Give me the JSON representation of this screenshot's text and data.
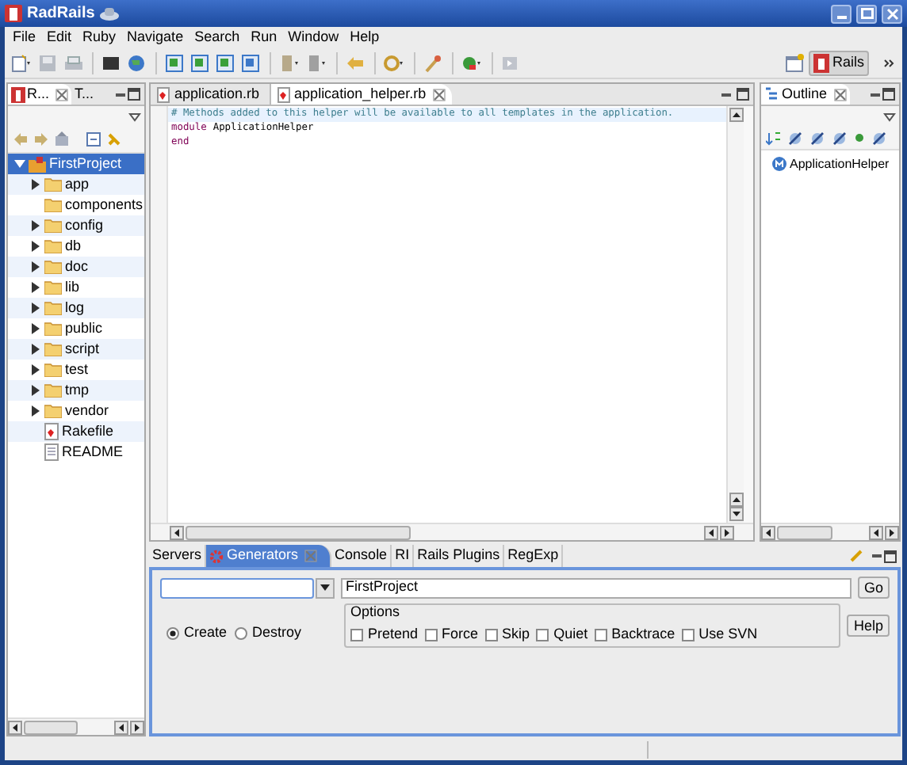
{
  "window": {
    "title": "RadRails"
  },
  "menu": [
    "File",
    "Edit",
    "Ruby",
    "Navigate",
    "Search",
    "Run",
    "Window",
    "Help"
  ],
  "toolbar": {
    "perspective": {
      "label": "Rails",
      "selected": true
    }
  },
  "explorer": {
    "tabs": [
      {
        "label": "R...",
        "selected": true
      },
      {
        "label": "T...",
        "selected": false
      }
    ],
    "tree": [
      {
        "label": "FirstProject",
        "kind": "project",
        "selected": true,
        "expandable": true,
        "expanded": true,
        "children": [
          {
            "label": "app",
            "kind": "folder",
            "selected": false,
            "expandable": true,
            "expanded": false
          },
          {
            "label": "components",
            "kind": "folder",
            "selected": false,
            "expandable": false
          },
          {
            "label": "config",
            "kind": "folder",
            "selected": false,
            "expandable": true,
            "expanded": false
          },
          {
            "label": "db",
            "kind": "folder",
            "selected": false,
            "expandable": true,
            "expanded": false
          },
          {
            "label": "doc",
            "kind": "folder",
            "selected": false,
            "expandable": true,
            "expanded": false
          },
          {
            "label": "lib",
            "kind": "folder",
            "selected": false,
            "expandable": true,
            "expanded": false
          },
          {
            "label": "log",
            "kind": "folder",
            "selected": false,
            "expandable": true,
            "expanded": false
          },
          {
            "label": "public",
            "kind": "folder",
            "selected": false,
            "expandable": true,
            "expanded": false
          },
          {
            "label": "script",
            "kind": "folder",
            "selected": false,
            "expandable": true,
            "expanded": false
          },
          {
            "label": "test",
            "kind": "folder",
            "selected": false,
            "expandable": true,
            "expanded": false
          },
          {
            "label": "tmp",
            "kind": "folder",
            "selected": false,
            "expandable": true,
            "expanded": false
          },
          {
            "label": "vendor",
            "kind": "folder",
            "selected": false,
            "expandable": true,
            "expanded": false
          },
          {
            "label": "Rakefile",
            "kind": "rakefile",
            "selected": false,
            "expandable": false
          },
          {
            "label": "README",
            "kind": "textfile",
            "selected": false,
            "expandable": false
          }
        ]
      }
    ]
  },
  "editor": {
    "tabs": [
      {
        "label": "application.rb",
        "selected": false
      },
      {
        "label": "application_helper.rb",
        "selected": true
      }
    ],
    "lines": [
      {
        "current": true,
        "tokens": [
          {
            "kind": "comment",
            "text": "# Methods added to this helper will be available to all templates in the application."
          }
        ]
      },
      {
        "current": false,
        "tokens": [
          {
            "kind": "keyword",
            "text": "module"
          },
          {
            "kind": "plain",
            "text": "ApplicationHelper"
          }
        ]
      },
      {
        "current": false,
        "tokens": [
          {
            "kind": "keyword",
            "text": "end"
          }
        ]
      }
    ]
  },
  "outline": {
    "tab": "Outline",
    "items": [
      "ApplicationHelper"
    ]
  },
  "bottom_panel": {
    "tabs": [
      {
        "label": "Servers",
        "selected": false
      },
      {
        "label": "Generators",
        "selected": true
      },
      {
        "label": "Console",
        "selected": false
      },
      {
        "label": "RI",
        "selected": false
      },
      {
        "label": "Rails Plugins",
        "selected": false
      },
      {
        "label": "RegExp",
        "selected": false
      }
    ],
    "generator": {
      "field_value": "FirstProject",
      "go": "Go",
      "help": "Help",
      "modes": [
        {
          "label": "Create",
          "selected": true
        },
        {
          "label": "Destroy",
          "selected": false
        }
      ],
      "options_title": "Options",
      "options": [
        {
          "label": "Pretend",
          "checked": false
        },
        {
          "label": "Force",
          "checked": false
        },
        {
          "label": "Skip",
          "checked": false
        },
        {
          "label": "Quiet",
          "checked": false
        },
        {
          "label": "Backtrace",
          "checked": false
        },
        {
          "label": "Use SVN",
          "checked": false
        }
      ]
    }
  }
}
